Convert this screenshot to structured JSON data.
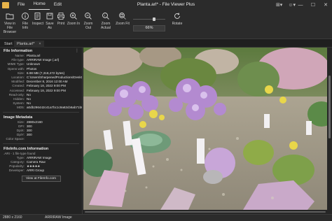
{
  "app": {
    "title": "Planta.arl* - File Viewer Plus",
    "menu": [
      "File",
      "Home",
      "Edit"
    ]
  },
  "ribbon": {
    "view_in_browser": "View in File Browser",
    "file_info": "File Info",
    "inspect": "Inspect",
    "save_as": "Save As",
    "print": "Print",
    "zoom_in": "Zoom In",
    "zoom_out": "Zoom Out",
    "zoom_actual": "Zoom Actual",
    "zoom_fit": "Zoom Fit",
    "zoom_value": "66%",
    "zoom_level": 0.66,
    "rotate": "Rotate"
  },
  "tabs": {
    "start": "Start",
    "file": "Planta.arl*",
    "close": "×"
  },
  "file_information": {
    "title": "File Information",
    "rows": [
      {
        "k": "Name:",
        "v": "Planta.arl"
      },
      {
        "k": "File type:",
        "v": "ARRIRAW Image (.arl)"
      },
      {
        "k": "MIME Type:",
        "v": "Unknown"
      },
      {
        "k": "Opens with:",
        "v": "Photos"
      },
      {
        "k": "Size:",
        "v": "6.98 MB (7,318,472 bytes)"
      },
      {
        "k": "Location:",
        "v": "C:\\Users\\SharpenedProductions\\Desktop\\"
      },
      {
        "k": "Modified:",
        "v": "December 8, 2016 12:00 AM"
      },
      {
        "k": "Created:",
        "v": "February 18, 2022 9:00 PM"
      },
      {
        "k": "Accessed:",
        "v": "February 18, 2022 9:00 PM"
      },
      {
        "k": "Read-only:",
        "v": "No"
      },
      {
        "k": "Hidden:",
        "v": "No"
      },
      {
        "k": "System:",
        "v": "No"
      },
      {
        "k": "MD5:",
        "v": "a0db296442c41a7bc1c9a63cb6ab71b0"
      }
    ]
  },
  "image_metadata": {
    "title": "Image Metadata",
    "rows": [
      {
        "k": "Size:",
        "v": "2880x2160"
      },
      {
        "k": "DPI:",
        "v": "300"
      },
      {
        "k": "DpiX:",
        "v": "300"
      },
      {
        "k": "DpiY:",
        "v": "300"
      },
      {
        "k": "Color Space:",
        "v": ""
      }
    ]
  },
  "fileinfo": {
    "title": "FileInfo.com Information",
    "subtitle": ".ARI - 1 file type found",
    "rows": [
      {
        "k": "Type:",
        "v": "ARRIRAW Image"
      },
      {
        "k": "Category:",
        "v": "Camera Raw"
      },
      {
        "k": "Popularity:",
        "v": "★★★★★"
      },
      {
        "k": "Developer:",
        "v": "ARRI Group"
      }
    ],
    "popularity_stars": 5,
    "button": "View at FileInfo.com"
  },
  "status": {
    "dimensions": "2880 x 2160",
    "type": "ARRIRAW Image"
  },
  "icons": {
    "app": "app-icon",
    "panel_menu": "more-vertical-icon"
  }
}
